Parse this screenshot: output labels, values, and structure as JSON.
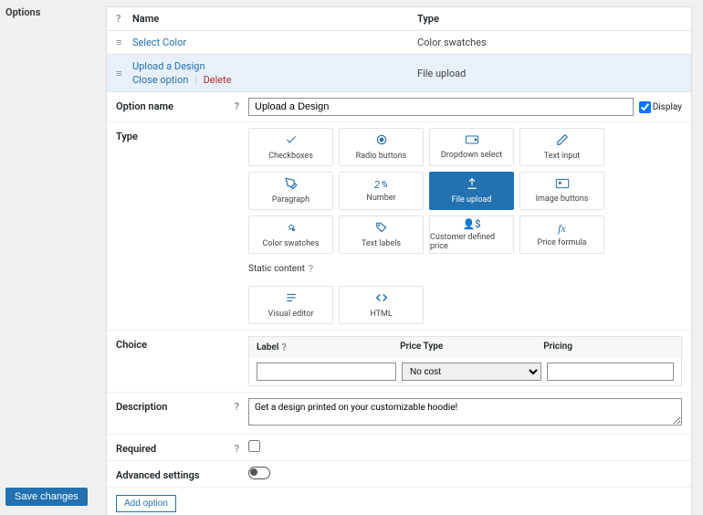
{
  "sidebar": {
    "label": "Options"
  },
  "header": {
    "name": "Name",
    "type": "Type"
  },
  "options": [
    {
      "name": "Select Color",
      "type": "Color swatches"
    },
    {
      "name": "Upload a Design",
      "type": "File upload",
      "close": "Close option",
      "delete": "Delete"
    }
  ],
  "form": {
    "option_name": {
      "label": "Option name",
      "value": "Upload a Design",
      "display": "Display"
    },
    "type_label": "Type",
    "types": [
      {
        "id": "checkboxes",
        "label": "Checkboxes",
        "icon": "check"
      },
      {
        "id": "radio",
        "label": "Radio buttons",
        "icon": "radio"
      },
      {
        "id": "dropdown",
        "label": "Dropdown select",
        "icon": "dropdown"
      },
      {
        "id": "text-input",
        "label": "Text input",
        "icon": "pencil"
      },
      {
        "id": "paragraph",
        "label": "Paragraph",
        "icon": "pen"
      },
      {
        "id": "number",
        "label": "Number",
        "icon": "number"
      },
      {
        "id": "file-upload",
        "label": "File upload",
        "icon": "upload",
        "selected": true
      },
      {
        "id": "image-buttons",
        "label": "Image buttons",
        "icon": "image"
      },
      {
        "id": "color-swatches",
        "label": "Color swatches",
        "icon": "swatch"
      },
      {
        "id": "text-labels",
        "label": "Text labels",
        "icon": "tag"
      },
      {
        "id": "customer-price",
        "label": "Customer defined price",
        "icon": "person"
      },
      {
        "id": "price-formula",
        "label": "Price formula",
        "icon": "fx"
      }
    ],
    "static_label": "Static content",
    "static_types": [
      {
        "id": "visual-editor",
        "label": "Visual editor",
        "icon": "editor"
      },
      {
        "id": "html",
        "label": "HTML",
        "icon": "html"
      }
    ],
    "choice_label": "Choice",
    "choice": {
      "cols": [
        "Label",
        "Price Type",
        "Pricing"
      ],
      "price_type": "No cost"
    },
    "description": {
      "label": "Description",
      "value": "Get a design printed on your customizable hoodie!"
    },
    "required_label": "Required",
    "advanced_label": "Advanced settings",
    "add_option": "Add option"
  },
  "save_button": "Save changes"
}
